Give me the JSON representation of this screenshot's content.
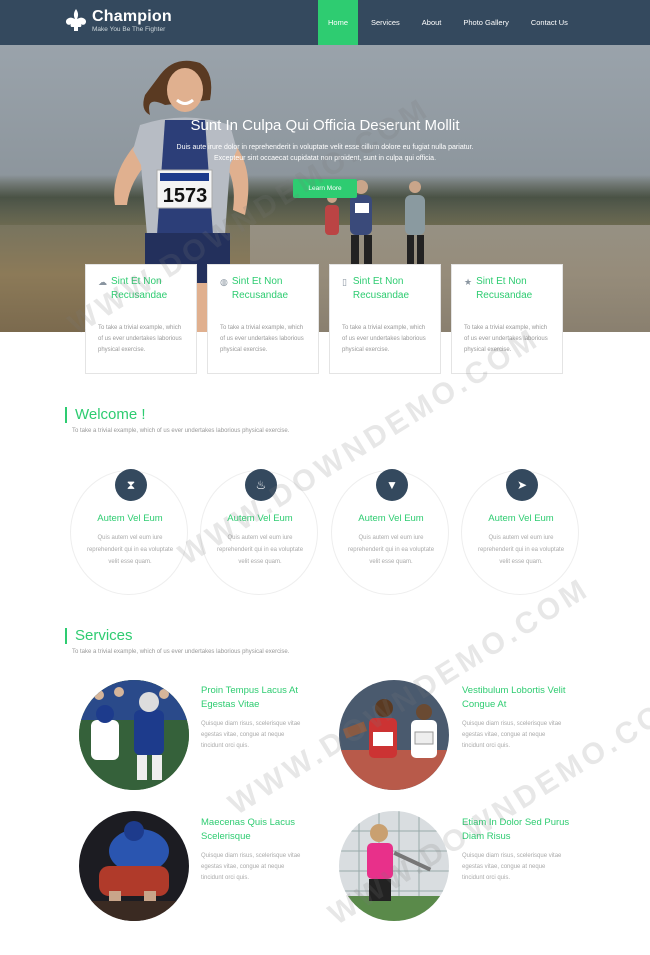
{
  "brand": {
    "name": "Champion",
    "tagline": "Make You Be The Fighter"
  },
  "nav": {
    "items": [
      "Home",
      "Services",
      "About",
      "Photo Gallery",
      "Contact Us"
    ],
    "active": "Home"
  },
  "hero": {
    "title": "Sunt In Culpa Qui Officia Deserunt Mollit",
    "line1": "Duis aute irure dolor in reprehenderit in voluptate velit esse cillum dolore eu fugiat nulla pariatur.",
    "line2": "Excepteur sint occaecat cupidatat non proident, sunt in culpa qui officia.",
    "button": "Learn More",
    "bib": "1573"
  },
  "features": [
    {
      "icon": "cloud-icon",
      "glyph": "☁",
      "title": "Sint Et Non Recusandae",
      "text": "To take a trivial example, which of us ever undertakes laborious physical exercise."
    },
    {
      "icon": "globe-icon",
      "glyph": "◍",
      "title": "Sint Et Non Recusandae",
      "text": "To take a trivial example, which of us ever undertakes laborious physical exercise."
    },
    {
      "icon": "mobile-icon",
      "glyph": "▯",
      "title": "Sint Et Non Recusandae",
      "text": "To take a trivial example, which of us ever undertakes laborious physical exercise."
    },
    {
      "icon": "star-icon",
      "glyph": "★",
      "title": "Sint Et Non Recusandae",
      "text": "To take a trivial example, which of us ever undertakes laborious physical exercise."
    }
  ],
  "welcome": {
    "heading": "Welcome !",
    "sub": "To take a trivial example, which of us ever undertakes laborious physical exercise.",
    "items": [
      {
        "icon": "hourglass-icon",
        "glyph": "⧗",
        "title": "Autem Vel Eum",
        "text": "Quis autem vel eum iure reprehenderit qui in ea voluptate velit esse quam."
      },
      {
        "icon": "fire-icon",
        "glyph": "♨",
        "title": "Autem Vel Eum",
        "text": "Quis autem vel eum iure reprehenderit qui in ea voluptate velit esse quam."
      },
      {
        "icon": "filter-icon",
        "glyph": "▼",
        "title": "Autem Vel Eum",
        "text": "Quis autem vel eum iure reprehenderit qui in ea voluptate velit esse quam."
      },
      {
        "icon": "plane-icon",
        "glyph": "➤",
        "title": "Autem Vel Eum",
        "text": "Quis autem vel eum iure reprehenderit qui in ea voluptate velit esse quam."
      }
    ]
  },
  "services": {
    "heading": "Services",
    "sub": "To take a trivial example, which of us ever undertakes laborious physical exercise.",
    "items": [
      {
        "title": "Proin Tempus Lacus At Egestas Vitae",
        "text": "Quisque diam risus, scelerisque vitae egestas vitae, congue at neque tincidunt orci quis."
      },
      {
        "title": "Vestibulum Lobortis Velit Congue At",
        "text": "Quisque diam risus, scelerisque vitae egestas vitae, congue at neque tincidunt orci quis."
      },
      {
        "title": "Maecenas Quis Lacus Scelerisque",
        "text": "Quisque diam risus, scelerisque vitae egestas vitae, congue at neque tincidunt orci quis."
      },
      {
        "title": "Etiam In Dolor Sed Purus Diam Risus",
        "text": "Quisque diam risus, scelerisque vitae egestas vitae, congue at neque tincidunt orci quis."
      }
    ]
  },
  "watermark": "WWW.DOWNDEMO.COM",
  "colors": {
    "nav": "#34495e",
    "accent": "#2ecc71",
    "icon_bg": "#34495e"
  }
}
